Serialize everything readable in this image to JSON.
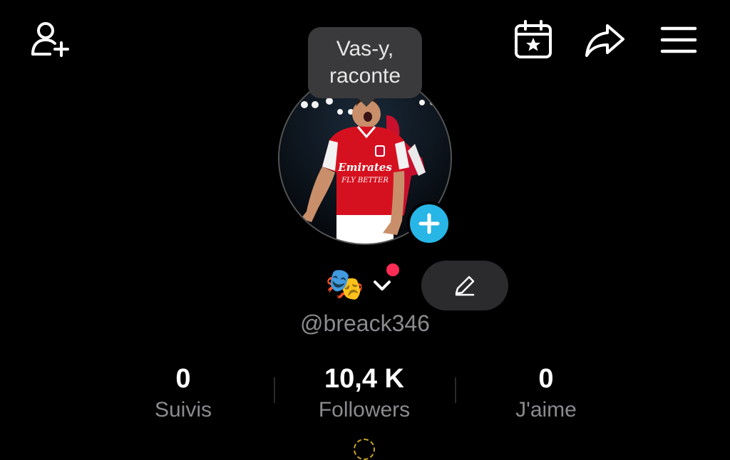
{
  "header": {
    "icons": [
      "add-user-icon",
      "calendar-star-icon",
      "share-icon",
      "menu-icon"
    ]
  },
  "tooltip": {
    "text": "Vas-y,\nraconte"
  },
  "profile": {
    "handle": "@breack346",
    "emoji": "🎭",
    "jersey_sponsor_line1": "Emirates",
    "jersey_sponsor_line2": "FLY BETTER"
  },
  "stats": [
    {
      "value": "0",
      "label": "Suivis"
    },
    {
      "value": "10,4 K",
      "label": "Followers"
    },
    {
      "value": "0",
      "label": "J'aime"
    }
  ],
  "colors": {
    "background": "#000000",
    "accent": "#27b6e6",
    "notification": "#ff2d55",
    "muted_text": "#8b8b8f"
  }
}
